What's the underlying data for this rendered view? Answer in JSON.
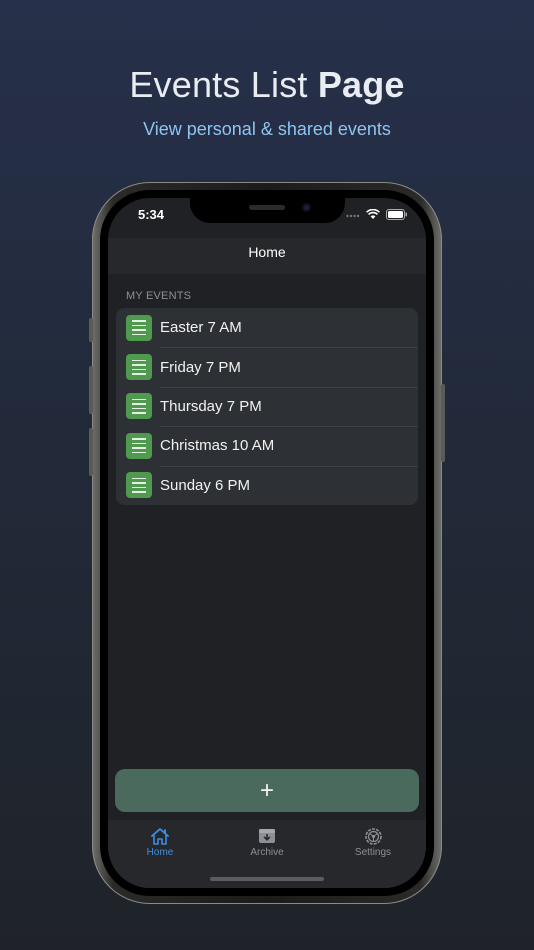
{
  "header": {
    "title_regular": "Events List",
    "title_bold": "Page",
    "subtitle": "View personal & shared events"
  },
  "status_bar": {
    "time": "5:34",
    "icons": [
      "signal-dots-icon",
      "wifi-icon",
      "battery-icon"
    ]
  },
  "navbar": {
    "title": "Home"
  },
  "events_section": {
    "header": "MY EVENTS",
    "items": [
      {
        "label": "Easter 7 AM",
        "icon": "list-icon"
      },
      {
        "label": "Friday 7 PM",
        "icon": "list-icon"
      },
      {
        "label": "Thursday 7 PM",
        "icon": "list-icon"
      },
      {
        "label": "Christmas 10 AM",
        "icon": "list-icon"
      },
      {
        "label": "Sunday 6 PM",
        "icon": "list-icon"
      }
    ]
  },
  "add_button": {
    "label": "+"
  },
  "tab_bar": {
    "tabs": [
      {
        "label": "Home",
        "icon": "house-icon",
        "active": true
      },
      {
        "label": "Archive",
        "icon": "archive-box-icon",
        "active": false
      },
      {
        "label": "Settings",
        "icon": "gear-icon",
        "active": false
      }
    ]
  },
  "colors": {
    "accent": "#3f8ee0",
    "subtitle": "#8fc4f2",
    "event_icon": "#4f9a4f",
    "add_button": "#4a6a5e"
  }
}
